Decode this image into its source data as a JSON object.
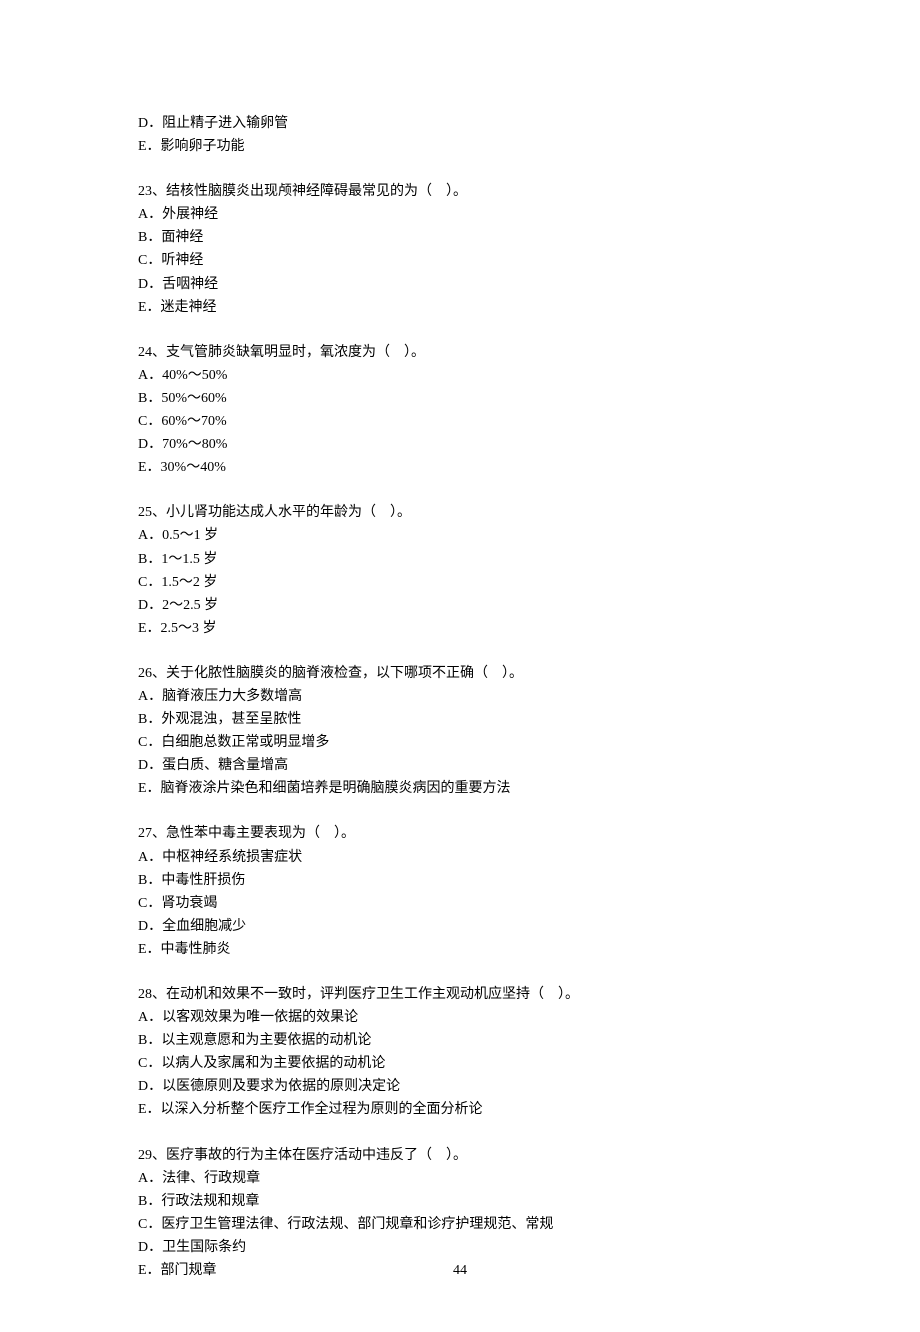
{
  "prev": {
    "optD": "D．阻止精子进入输卵管",
    "optE": "E．影响卵子功能"
  },
  "q23": {
    "stem": "23、结核性脑膜炎出现颅神经障碍最常见的为（　）。",
    "A": "A．外展神经",
    "B": "B．面神经",
    "C": "C．听神经",
    "D": "D．舌咽神经",
    "E": "E．迷走神经"
  },
  "q24": {
    "stem": "24、支气管肺炎缺氧明显时，氧浓度为（　）。",
    "A": "A．40%～50%",
    "B": "B．50%～60%",
    "C": "C．60%～70%",
    "D": "D．70%～80%",
    "E": "E．30%～40%"
  },
  "q25": {
    "stem": "25、小儿肾功能达成人水平的年龄为（　）。",
    "A": "A．0.5～1 岁",
    "B": "B．1～1.5 岁",
    "C": "C．1.5～2 岁",
    "D": "D．2～2.5 岁",
    "E": "E．2.5～3 岁"
  },
  "q26": {
    "stem": "26、关于化脓性脑膜炎的脑脊液检查，以下哪项不正确（　）。",
    "A": "A．脑脊液压力大多数增高",
    "B": "B．外观混浊，甚至呈脓性",
    "C": "C．白细胞总数正常或明显增多",
    "D": "D．蛋白质、糖含量增高",
    "E": "E．脑脊液涂片染色和细菌培养是明确脑膜炎病因的重要方法"
  },
  "q27": {
    "stem": "27、急性苯中毒主要表现为（　）。",
    "A": "A．中枢神经系统损害症状",
    "B": "B．中毒性肝损伤",
    "C": "C．肾功衰竭",
    "D": "D．全血细胞减少",
    "E": "E．中毒性肺炎"
  },
  "q28": {
    "stem": "28、在动机和效果不一致时，评判医疗卫生工作主观动机应坚持（　）。",
    "A": "A．以客观效果为唯一依据的效果论",
    "B": "B．以主观意愿和为主要依据的动机论",
    "C": "C．以病人及家属和为主要依据的动机论",
    "D": "D．以医德原则及要求为依据的原则决定论",
    "E": "E．以深入分析整个医疗工作全过程为原则的全面分析论"
  },
  "q29": {
    "stem": "29、医疗事故的行为主体在医疗活动中违反了（　）。",
    "A": "A．法律、行政规章",
    "B": "B．行政法规和规章",
    "C": "C．医疗卫生管理法律、行政法规、部门规章和诊疗护理规范、常规",
    "D": "D．卫生国际条约",
    "E": "E．部门规章"
  },
  "pageNumber": "44"
}
